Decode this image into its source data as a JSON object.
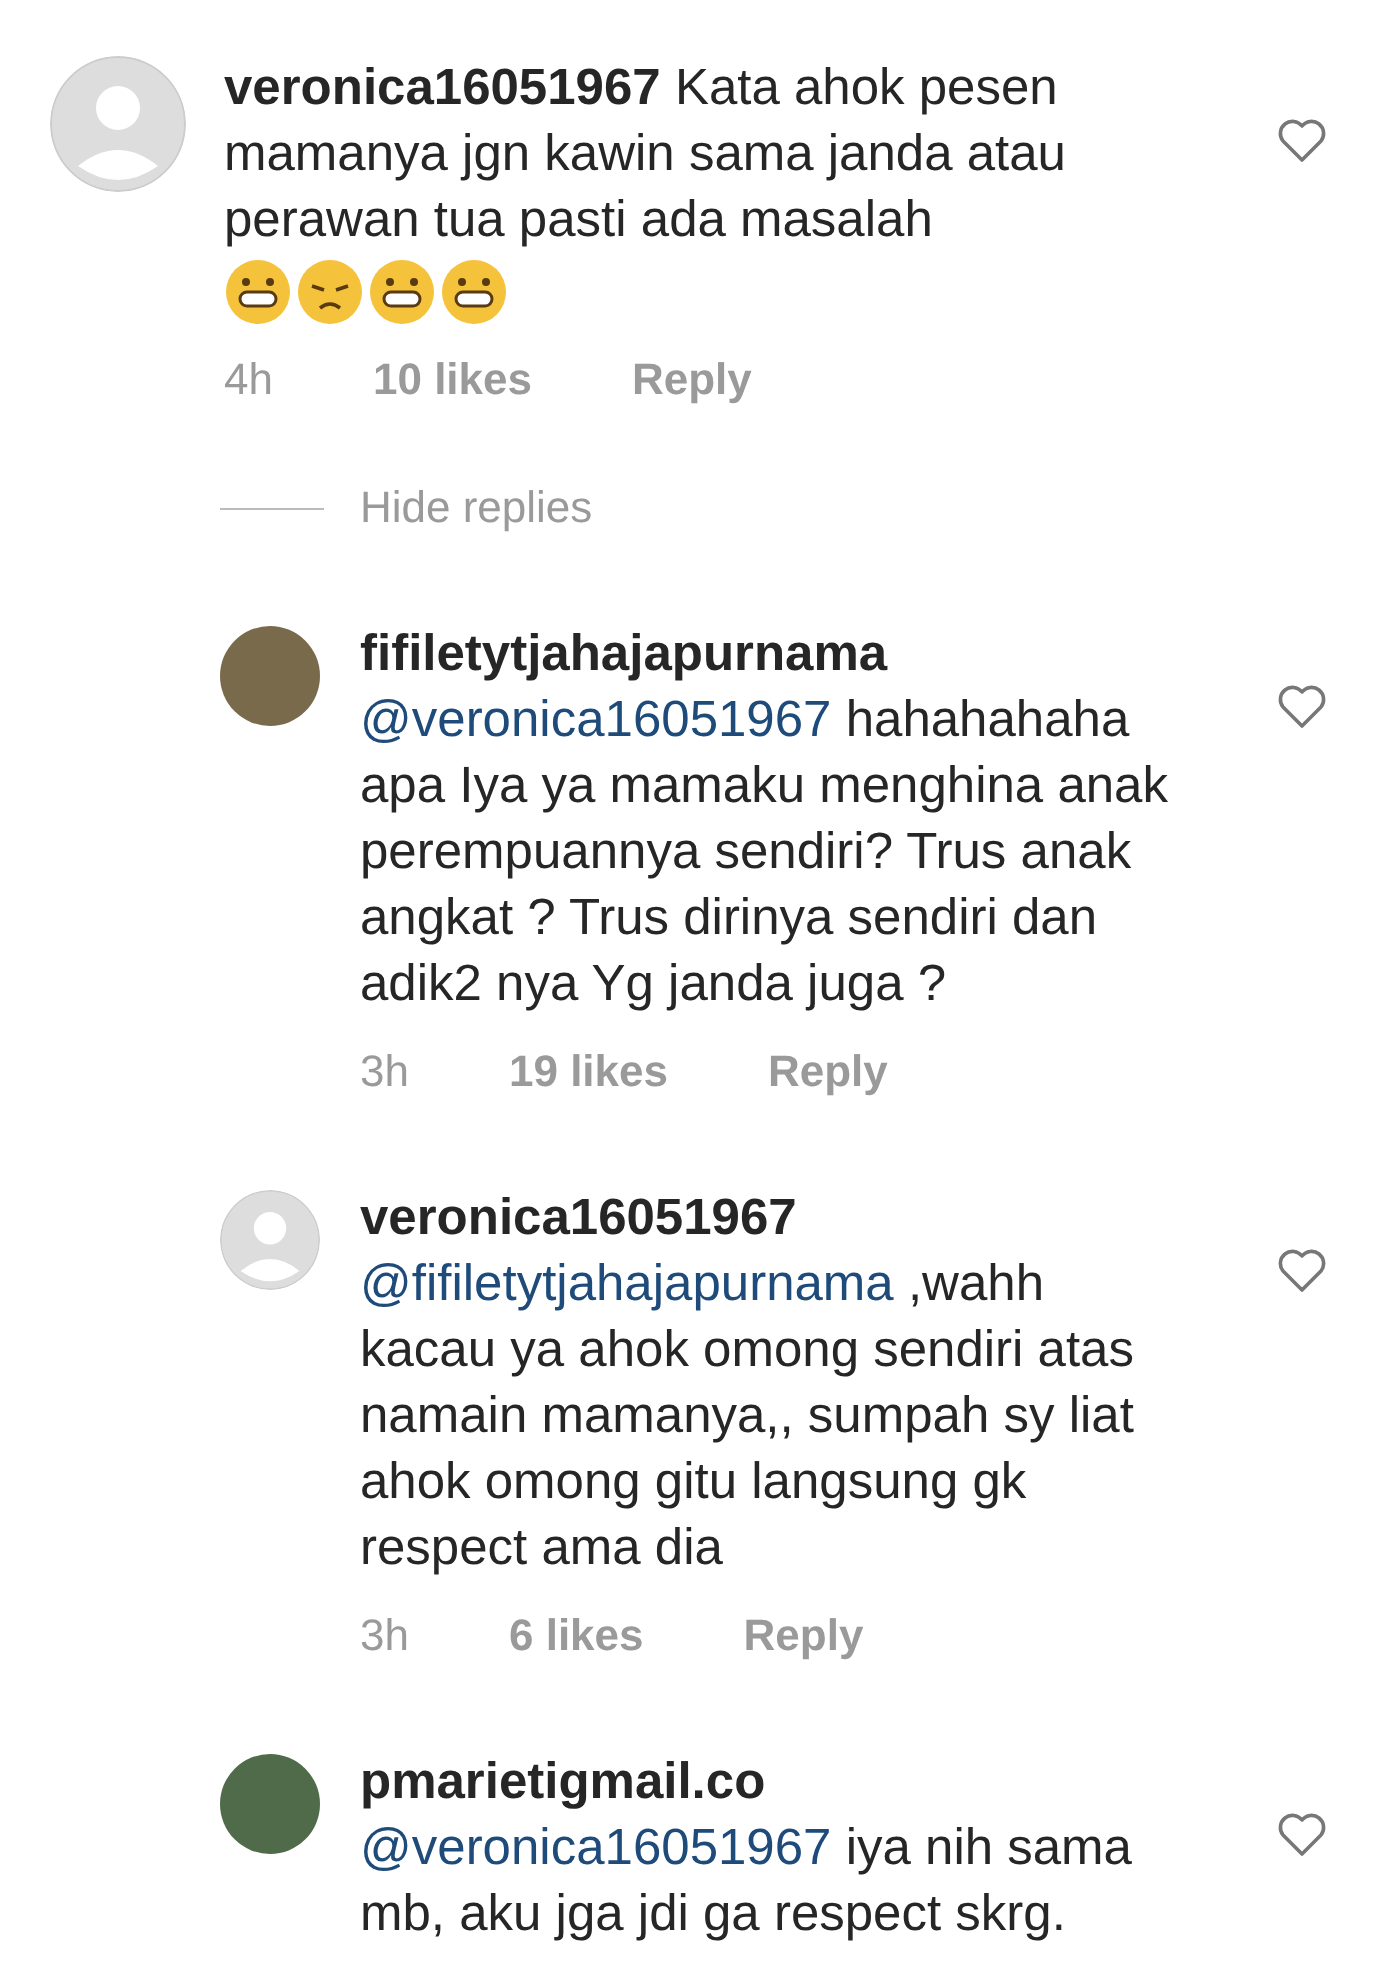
{
  "comments": [
    {
      "username": "veronica16051967",
      "avatar": {
        "kind": "default"
      },
      "text": "Kata ahok pesen mamanya jgn kawin sama janda atau perawan tua pasti ada masalah",
      "emojis": [
        {
          "kind": "grin"
        },
        {
          "kind": "sad"
        },
        {
          "kind": "laugh"
        },
        {
          "kind": "grin"
        }
      ],
      "time": "4h",
      "likes": "10 likes",
      "reply": "Reply",
      "liked": false
    },
    {
      "divider": "Hide replies"
    },
    {
      "username": "fifiletytjahajapurnama",
      "avatar": {
        "kind": "photo"
      },
      "mention": "@veronica16051967",
      "text": "hahahahaha apa Iya  ya mamaku menghina anak perempuannya sendiri? Trus anak angkat ? Trus dirinya sendiri dan adik2 nya Yg janda juga ?",
      "time": "3h",
      "likes": "19 likes",
      "reply": "Reply",
      "liked": false
    },
    {
      "username": "veronica16051967",
      "avatar": {
        "kind": "default"
      },
      "mention": "@fifiletytjahajapurnama",
      "text": ",wahh kacau ya ahok omong sendiri atas namain mamanya,, sumpah sy liat ahok omong gitu langsung gk respect ama dia",
      "time": "3h",
      "likes": "6 likes",
      "reply": "Reply",
      "liked": false
    },
    {
      "username": "pmarietigmail.co",
      "avatar": {
        "kind": "photo"
      },
      "mention": "@veronica16051967",
      "text": "iya nih sama mb, aku jga jdi ga respect skrg.",
      "liked": false
    }
  ]
}
